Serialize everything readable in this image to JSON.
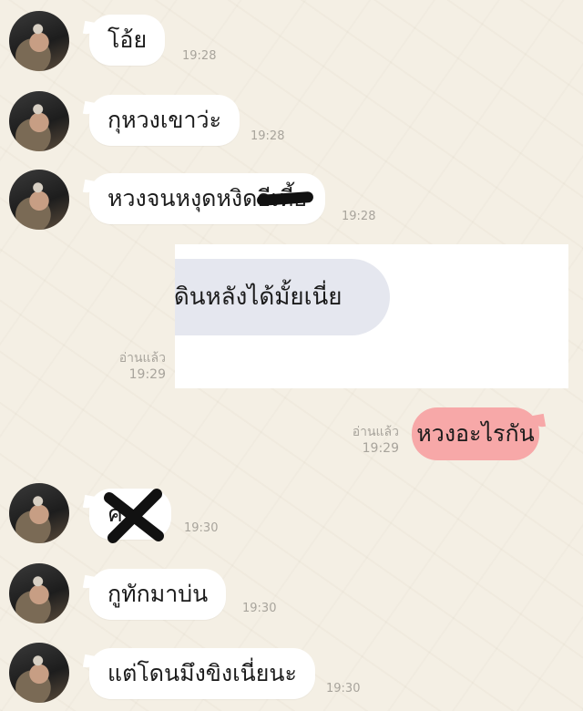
{
  "messages": [
    {
      "text": "โอ้ย",
      "time": "19:28"
    },
    {
      "text": "กุหวงเขาว่ะ",
      "time": "19:28"
    },
    {
      "text": "หวงจนหงุดหงิดอีเหี้ย",
      "time": "19:28"
    },
    {
      "text": "ค..",
      "time": "19:30"
    },
    {
      "text": "กูทักมาบ่น",
      "time": "19:30"
    },
    {
      "text": "แต่โดนมึงขิงเนี่ยนะ",
      "time": "19:30"
    }
  ],
  "overlay": {
    "text": "เดินหลังได้มั้ยเนี่ย",
    "read_label": "อ่านแล้ว",
    "time": "19:29"
  },
  "sent": {
    "text": "หวงอะไรกัน",
    "read_label": "อ่านแล้ว",
    "time": "19:29"
  }
}
